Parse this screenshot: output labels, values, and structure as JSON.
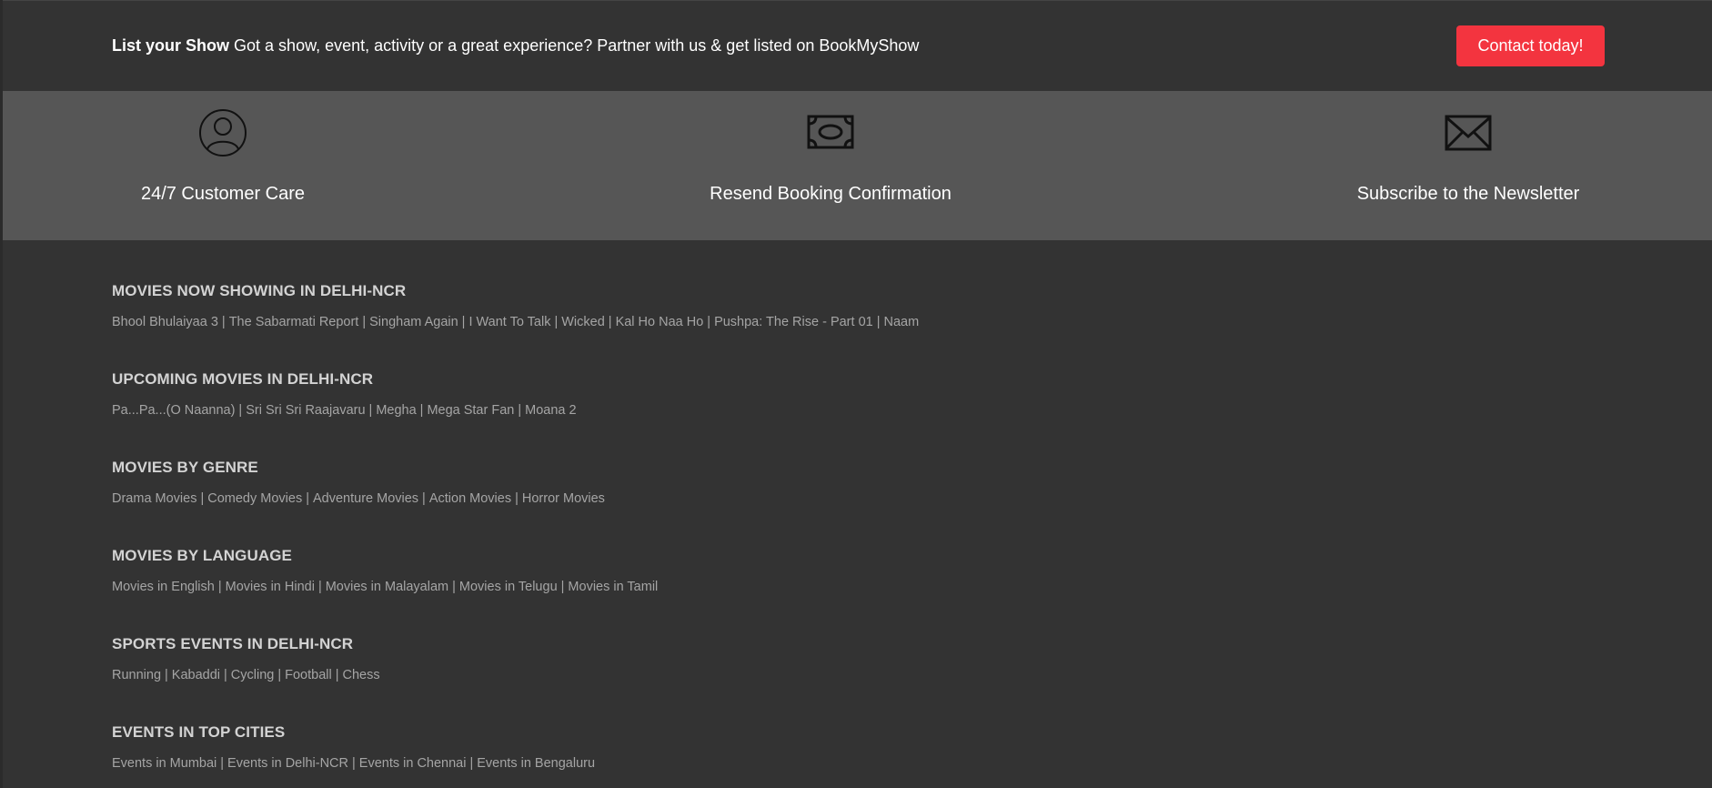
{
  "banner": {
    "title": "List your Show",
    "text": "Got a show, event, activity or a great experience? Partner with us & get listed on BookMyShow",
    "button_label": "Contact today!"
  },
  "services": [
    {
      "label": "24/7 Customer Care",
      "icon": "customer-care-icon"
    },
    {
      "label": "Resend Booking Confirmation",
      "icon": "ticket-icon"
    },
    {
      "label": "Subscribe to the Newsletter",
      "icon": "envelope-icon"
    }
  ],
  "sections": [
    {
      "heading": "MOVIES NOW SHOWING IN DELHI-NCR",
      "links": [
        "Bhool Bhulaiyaa 3",
        "The Sabarmati Report",
        "Singham Again",
        "I Want To Talk",
        "Wicked",
        "Kal Ho Naa Ho",
        "Pushpa: The Rise - Part 01",
        "Naam"
      ]
    },
    {
      "heading": "UPCOMING MOVIES IN DELHI-NCR",
      "links": [
        "Pa...Pa...(O Naanna)",
        "Sri Sri Sri Raajavaru",
        "Megha",
        "Mega Star Fan",
        "Moana 2"
      ]
    },
    {
      "heading": "MOVIES BY GENRE",
      "links": [
        "Drama Movies",
        "Comedy Movies",
        "Adventure Movies",
        "Action Movies",
        "Horror Movies"
      ]
    },
    {
      "heading": "MOVIES BY LANGUAGE",
      "links": [
        "Movies in English",
        "Movies in Hindi",
        "Movies in Malayalam",
        "Movies in Telugu",
        "Movies in Tamil"
      ]
    },
    {
      "heading": "SPORTS EVENTS IN DELHI-NCR",
      "links": [
        "Running",
        "Kabaddi",
        "Cycling",
        "Football",
        "Chess"
      ]
    },
    {
      "heading": "EVENTS IN TOP CITIES",
      "links": [
        "Events in Mumbai",
        "Events in Delhi-NCR",
        "Events in Chennai",
        "Events in Bengaluru"
      ]
    }
  ],
  "colors": {
    "accent": "#f3343f",
    "banner_bg": "#333333",
    "services_bg": "#565656",
    "footer_bg": "#333333"
  }
}
